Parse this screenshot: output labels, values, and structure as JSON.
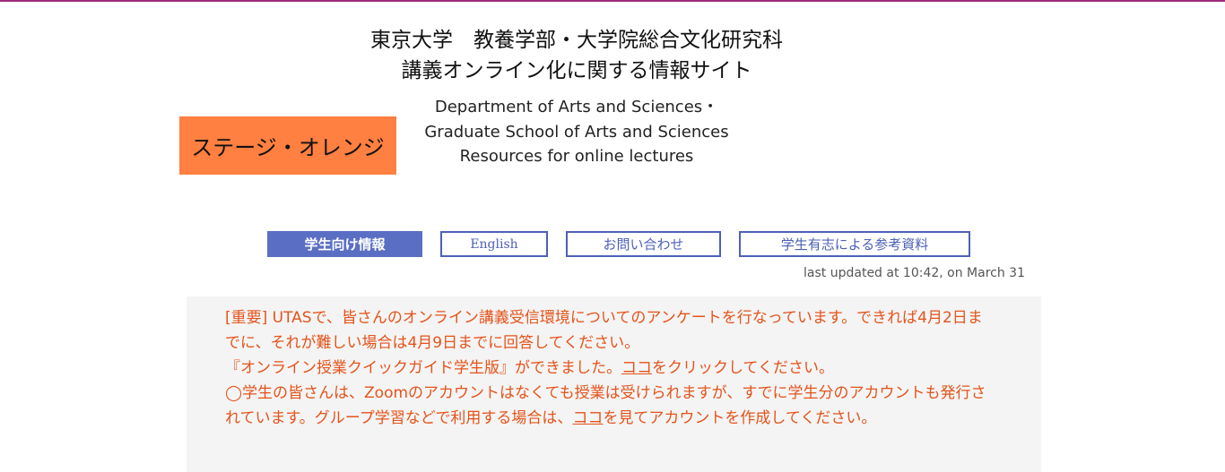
{
  "header": {
    "jp_title_line1": "東京大学　教養学部・大学院総合文化研究科",
    "jp_title_line2": "講義オンライン化に関する情報サイト",
    "en_title_line1": "Department of Arts and Sciences・",
    "en_title_line2": "Graduate School of Arts and Sciences",
    "en_title_line3": "Resources for online lectures",
    "stage_label": "ステージ・オレンジ"
  },
  "colors": {
    "stage_badge": "#ff8040",
    "nav_active": "#5a6fc4",
    "nav_outline": "#4d60b8",
    "notice_text": "#e5531a",
    "top_border": "#9b2a80"
  },
  "nav": {
    "students": "学生向け情報",
    "english": "English",
    "contact": "お問い合わせ",
    "volunteer_materials": "学生有志による参考資料"
  },
  "last_updated": "last updated at 10:42, on March 31",
  "notice": {
    "survey": "[重要] UTASで、皆さんのオンライン講義受信環境についてのアンケートを行なっています。できれば4月2日までに、それが難しい場合は4月9日までに回答してください。",
    "guide_before": "『オンライン授業クイックガイド学生版』ができました。",
    "guide_link": "ココ",
    "guide_after": "をクリックしてください。",
    "zoom_before": "◯学生の皆さんは、Zoomのアカウントはなくても授業は受けられますが、すでに学生分のアカウントも発行されています。グループ学習などで利用する場合は、",
    "zoom_link": "ココ",
    "zoom_after": "を見てアカウントを作成してください。"
  }
}
